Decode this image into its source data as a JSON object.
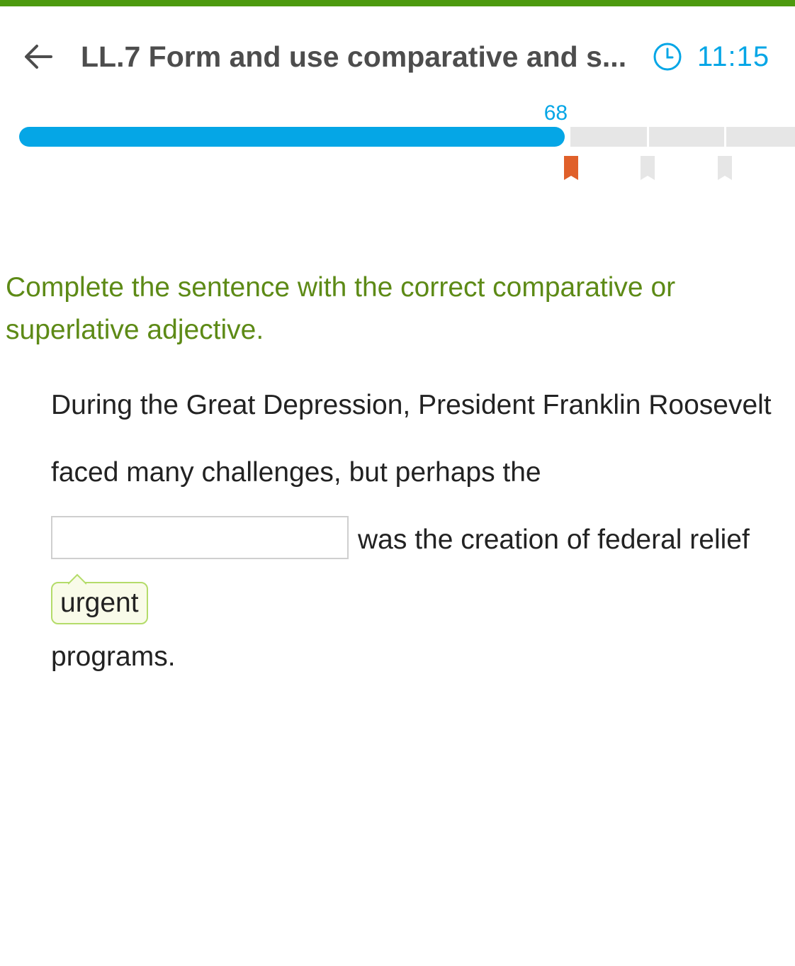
{
  "colors": {
    "top_bar": "#4d9a0f",
    "accent_blue": "#05a6e6",
    "prompt_green": "#5d8a16",
    "current_marker": "#e0602a",
    "future_marker": "#e6e6e6",
    "hint_border": "#b4dc6a",
    "hint_bg": "#f9fbe9"
  },
  "header": {
    "back_icon": "arrow-left-icon",
    "title": "LL.7 Form and use comparative and s...",
    "timer_icon": "clock-icon",
    "timer": "11:15"
  },
  "progress": {
    "score": "68",
    "progress_fraction": 0.68
  },
  "question": {
    "prompt": "Complete the sentence with the correct comparative or superlative adjective.",
    "line1": "During the Great Depression, President Franklin Roosevelt",
    "line2": "faced many challenges, but perhaps the",
    "answer_value": "",
    "line3": "was the creation of federal relief",
    "hint_word": "urgent",
    "line4": "programs."
  }
}
